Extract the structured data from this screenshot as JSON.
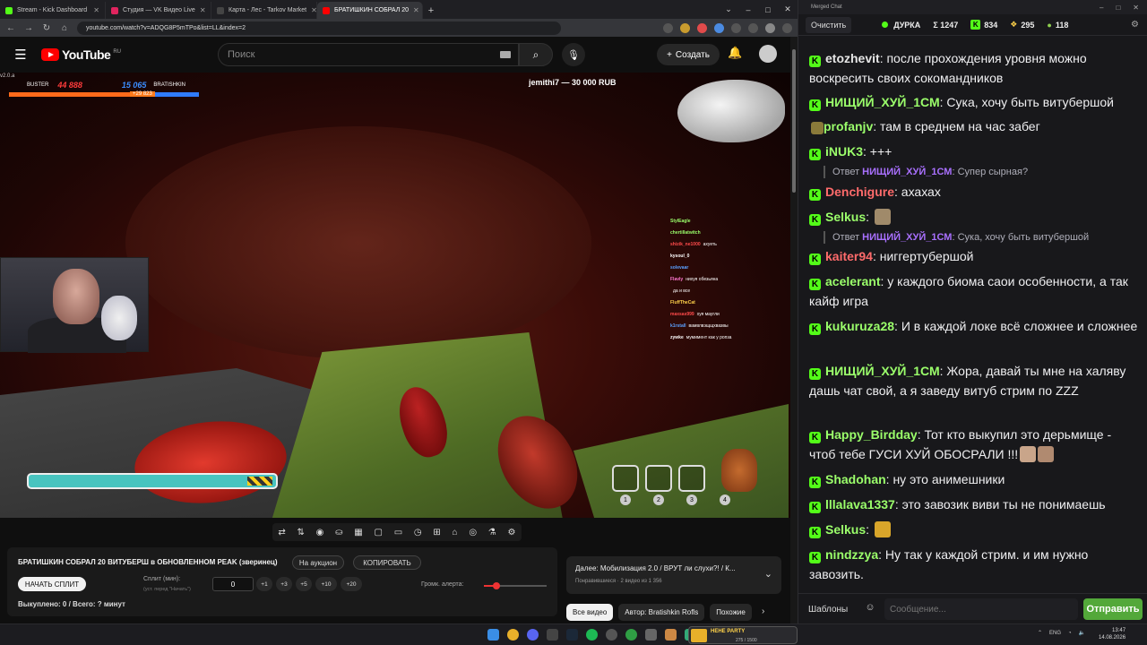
{
  "browser": {
    "tabs": [
      {
        "label": "Stream - Kick Dashboard",
        "color": "#53fc18",
        "active": false
      },
      {
        "label": "Студия — VK Видео Live",
        "color": "#e0245e",
        "active": false
      },
      {
        "label": "Карта - Лес - Tarkov Market",
        "color": "#444444",
        "active": false
      },
      {
        "label": "БРАТИШКИН СОБРАЛ 20",
        "color": "#ff0000",
        "active": true
      }
    ],
    "url": "youtube.com/watch?v=ADQG8P5mTPo&list=LL&index=2",
    "new_tab": "+",
    "win_controls": [
      "⌄",
      "–",
      "□",
      "✕"
    ]
  },
  "youtube": {
    "logo": "YouTube",
    "region": "RU",
    "search_placeholder": "Поиск",
    "create_label": "Создать",
    "icons": {
      "menu": "menu-icon",
      "search": "search-icon",
      "mic": "mic-icon",
      "bell": "bell-icon"
    }
  },
  "video": {
    "version": "v2.0.a",
    "hud": {
      "left_name": "BUSTER",
      "left_score": "44 888",
      "right_score": "15 065",
      "right_name": "BRATISHKIN",
      "bonus": "+29 823",
      "blue_fraction": 0.35
    },
    "donation": "jemithi7 — 30 000 RUB",
    "overlay_chat": [
      {
        "name": "StylEagle",
        "text": "",
        "color": "#9bff6b"
      },
      {
        "name": "chertillatwitch",
        "text": "",
        "color": "#9bff6b"
      },
      {
        "name": "shizik_ne1000",
        "text": "ахуеть",
        "color": "#ff4b4b"
      },
      {
        "name": "kysoul_0",
        "text": "",
        "color": "#ffffff"
      },
      {
        "name": "solevaar",
        "text": "",
        "color": "#5aa0ff"
      },
      {
        "name": "Flavly",
        "text": "нихуя обезьяна",
        "color": "#ff77d0"
      },
      {
        "name": "",
        "text": "да и все",
        "color": "#ffffff"
      },
      {
        "name": "FluffTheCat",
        "text": "",
        "color": "#ffd24a"
      },
      {
        "name": "maxsas999",
        "text": "хуя маугли",
        "color": "#ff4b4b"
      },
      {
        "name": "k1rstall",
        "text": "вамвлвэщщхвазвы",
        "color": "#5aa0ff"
      },
      {
        "name": "zywke",
        "text": "мумимент как у ропза",
        "color": "#ffffff"
      }
    ],
    "slots": [
      "1",
      "2",
      "3",
      "4"
    ]
  },
  "toolbar_icons": [
    "loop-icon",
    "sort-icon",
    "broadcast-icon",
    "record-icon",
    "calendar-icon",
    "crop-icon",
    "mini-icon",
    "gauge-icon",
    "add-icon",
    "monitor-icon",
    "camera-icon",
    "flask-icon",
    "settings-icon"
  ],
  "panel": {
    "title": "БРАТИШКИН СОБРАЛ 20 ВИТУБЕРШ в ОБНОВЛЕННОМ PEAK (зверинец)",
    "auction_btn": "На аукцион",
    "copy_btn": "КОПИРОВАТЬ",
    "split_btn": "НАЧАТЬ СПЛИТ",
    "split_label": "Сплит (мин):",
    "split_sub": "(уст. перед \"Начать\")",
    "split_value": "0",
    "steps": [
      "+1",
      "+3",
      "+5",
      "+10",
      "+20"
    ],
    "volume_label": "Громк. алерта:",
    "volume_fraction": 0.2,
    "footer": "Выкуплено: 0 / Всего: ? минут"
  },
  "next": {
    "title": "Далее: Мобилизация 2.0 / ВРУТ ли слухи?! / К...",
    "subtitle": "Понравившиеся · 2 видео из 1 356"
  },
  "chips": [
    {
      "label": "Все видео",
      "on": true
    },
    {
      "label": "Автор: Bratishkin Rofls",
      "on": false
    },
    {
      "label": "Похожие",
      "on": false
    }
  ],
  "taskbar": {
    "media_title": "HEHE PARTY",
    "media_count": "275 / 1500",
    "lang": "ENG",
    "time": "13:47",
    "date": "14.08.2026"
  },
  "chat": {
    "window_title": "Merged Chat",
    "clear_btn": "Очистить",
    "streamer": "ДУРКА",
    "stats": {
      "total": "Σ 1247",
      "kick": "834",
      "vk": "295",
      "other": "118"
    },
    "messages": [
      {
        "user": "etozhevit",
        "color": "#e6e6e6",
        "text": "после прохождения уровня можно воскресить своих сокомандников"
      },
      {
        "user": "НИЩИЙ_ХУЙ_1СМ",
        "color": "#9bff6b",
        "text": "Сука, хочу быть витубершой"
      },
      {
        "user": "profanjv",
        "color": "#9bff6b",
        "text": "там в среднем на час забег"
      },
      {
        "user": "iNUK3",
        "color": "#9bff6b",
        "text": "+++"
      },
      {
        "user": "Denchigure",
        "color": "#ff6b6b",
        "text": "ахахах"
      },
      {
        "user": "Selkus",
        "color": "#9bff6b",
        "text": ""
      },
      {
        "user": "kaiter94",
        "color": "#ff6b6b",
        "text": "ниггертубершой"
      },
      {
        "user": "acelerant",
        "color": "#9bff6b",
        "text": "у каждого биома саои особенности, а так кайф игра"
      },
      {
        "user": "kukuruza28",
        "color": "#9bff6b",
        "text": "И в каждой локе всё сложнее и сложнее"
      },
      {
        "user": "НИЩИЙ_ХУЙ_1СМ",
        "color": "#9bff6b",
        "text": "Жора, давай ты мне на халяву дашь чат свой, а я заведу витуб стрим по ZZZ"
      },
      {
        "user": "Happy_Birdday",
        "color": "#9bff6b",
        "text": "Тот кто выкупил это дерьмище - чтоб тебе ГУСИ ХУЙ ОБОСРАЛИ !!!"
      },
      {
        "user": "Shadohan",
        "color": "#9bff6b",
        "text": "ну это анимешники"
      },
      {
        "user": "lllalava1337",
        "color": "#9bff6b",
        "text": "это завозик виви ты не понимаешь"
      },
      {
        "user": "Selkus",
        "color": "#9bff6b",
        "text": ""
      },
      {
        "user": "nindzzya",
        "color": "#9bff6b",
        "text": "Ну так у каждой стрим. и им нужно завозить."
      }
    ],
    "replies": [
      {
        "prefix": "Ответ",
        "user": "НИЩИЙ_ХУЙ_1СМ",
        "text": "Супер сырная?"
      },
      {
        "prefix": "Ответ",
        "user": "НИЩИЙ_ХУЙ_1СМ",
        "text": "Сука, хочу быть витубершой"
      }
    ],
    "templates_btn": "Шаблоны",
    "input_placeholder": "Сообщение...",
    "send_btn": "Отправить"
  }
}
